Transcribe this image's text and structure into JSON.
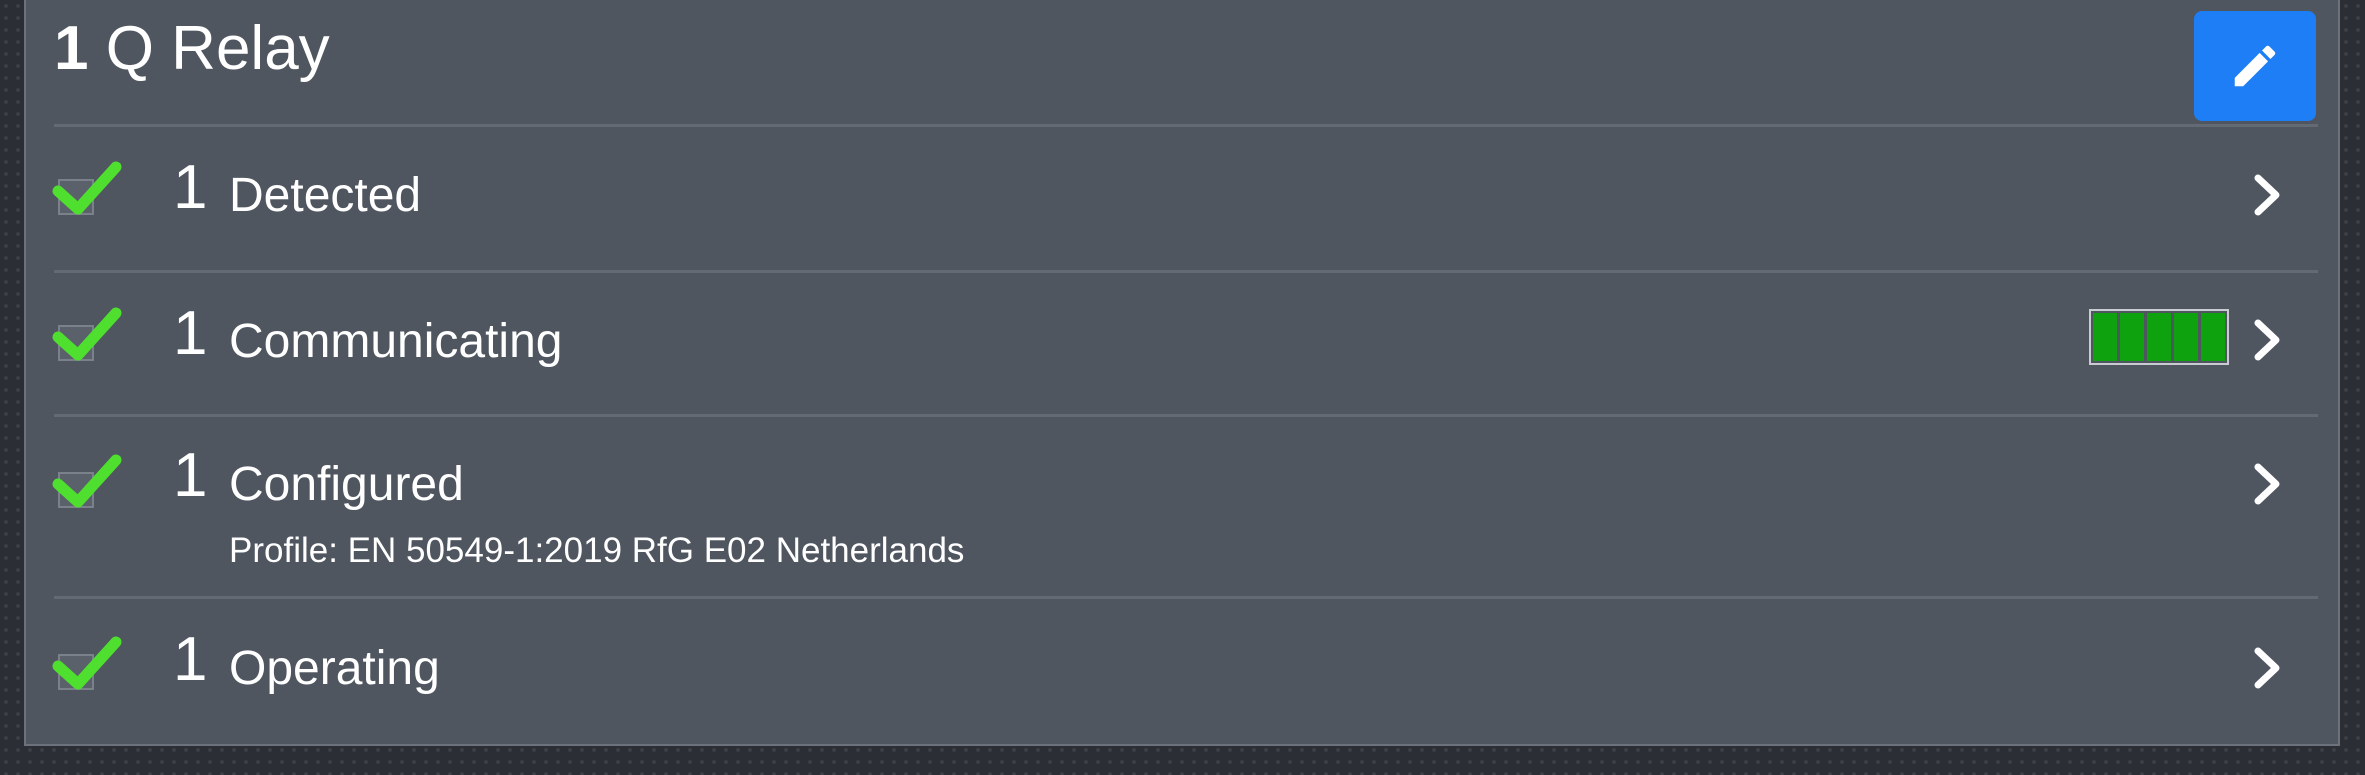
{
  "panel": {
    "title_count": "1",
    "title_text": "Q Relay",
    "edit_icon": "pencil-icon",
    "accent_color": "#1e7ef5"
  },
  "rows": [
    {
      "count": "1",
      "label": "Detected",
      "status": "checked",
      "chevron_icon": "chevron-right-icon"
    },
    {
      "count": "1",
      "label": "Communicating",
      "status": "checked",
      "signal_strength": 1.0,
      "signal_segments": 5,
      "chevron_icon": "chevron-right-icon"
    },
    {
      "count": "1",
      "label": "Configured",
      "sublabel": "Profile: EN 50549-1:2019 RfG E02 Netherlands",
      "status": "checked",
      "chevron_icon": "chevron-right-icon"
    },
    {
      "count": "1",
      "label": "Operating",
      "status": "checked",
      "chevron_icon": "chevron-right-icon"
    }
  ],
  "colors": {
    "check": "#4fe02f",
    "signal_bar": "#0ea30e",
    "panel_bg": "#4f5660"
  }
}
